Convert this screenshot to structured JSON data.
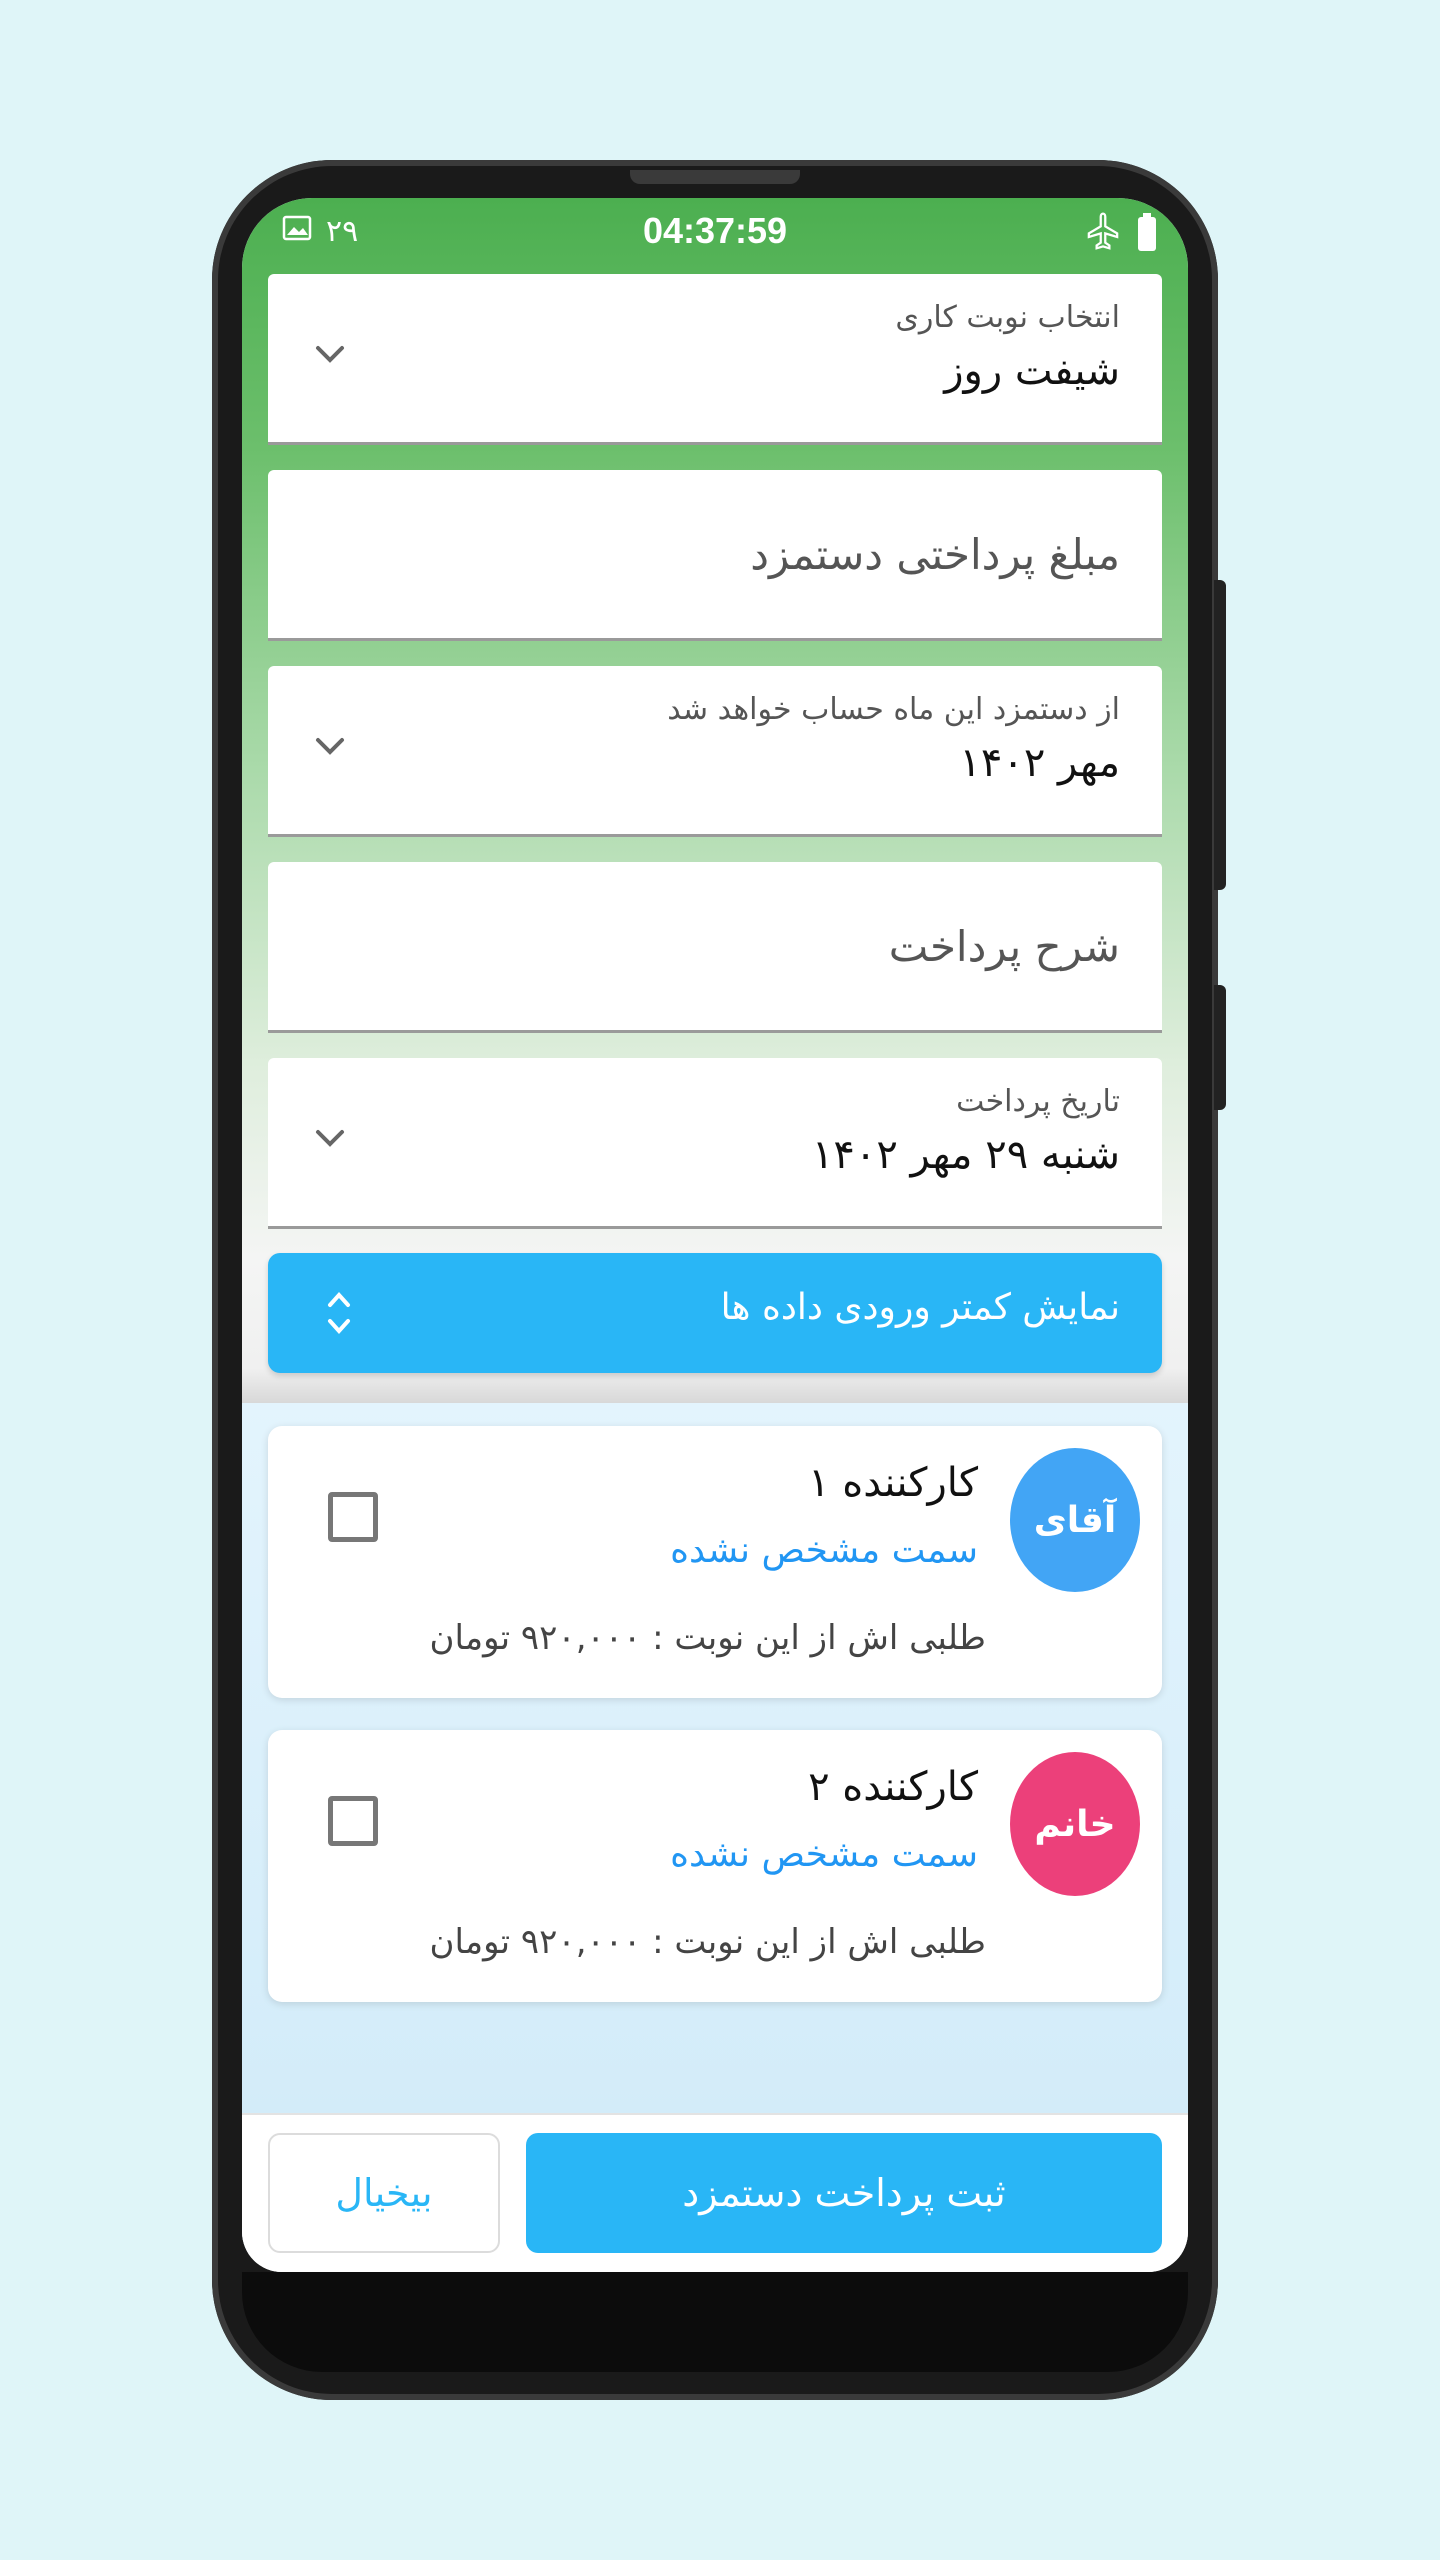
{
  "status_bar": {
    "day": "۲۹",
    "time": "04:37:59",
    "left_icon": "image-icon",
    "right_icons": [
      "airplane-icon",
      "battery-icon"
    ]
  },
  "form": {
    "shift": {
      "label": "انتخاب نوبت کاری",
      "value": "شیفت روز"
    },
    "amount": {
      "placeholder": "مبلغ پرداختی دستمزد"
    },
    "month": {
      "label": "از دستمزد این ماه حساب خواهد شد",
      "value": "مهر ۱۴۰۲"
    },
    "description": {
      "placeholder": "شرح پرداخت"
    },
    "date": {
      "label": "تاریخ پرداخت",
      "value": "شنبه ۲۹ مهر ۱۴۰۲"
    }
  },
  "toggle": {
    "label": "نمایش کمتر ورودی داده ها"
  },
  "employees": [
    {
      "avatar_text": "آقای",
      "avatar_color": "#42a5f5",
      "name": "کارکننده ۱",
      "role": "سمت مشخص نشده",
      "salary": "طلبی اش از این نوبت : ۹۲۰,۰۰۰ تومان",
      "checked": false
    },
    {
      "avatar_text": "خانم",
      "avatar_color": "#ec407a",
      "name": "کارکننده ۲",
      "role": "سمت مشخص نشده",
      "salary": "طلبی اش از این نوبت : ۹۲۰,۰۰۰ تومان",
      "checked": false
    }
  ],
  "actions": {
    "submit": "ثبت پرداخت دستمزد",
    "cancel": "بیخیال"
  },
  "colors": {
    "primary": "#29b6f6",
    "header_green": "#4caf50",
    "role_blue": "#2196f3"
  }
}
